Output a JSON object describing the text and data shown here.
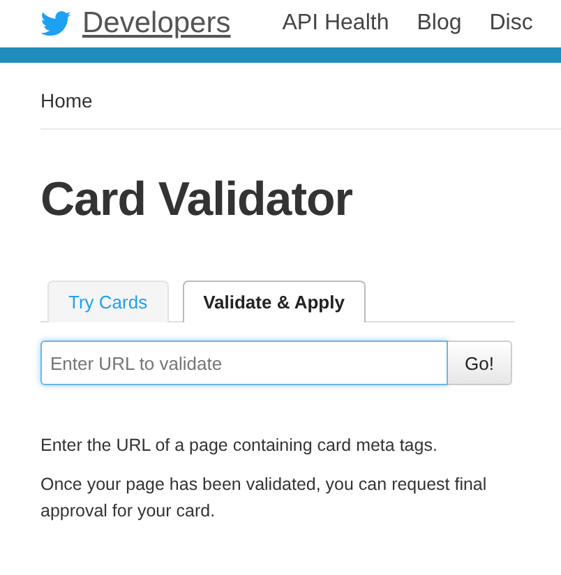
{
  "header": {
    "brand": "Developers",
    "nav": [
      "API Health",
      "Blog",
      "Disc"
    ]
  },
  "breadcrumb": [
    "Home"
  ],
  "title": "Card Validator",
  "tabs": [
    {
      "label": "Try Cards",
      "selected": false
    },
    {
      "label": "Validate & Apply",
      "selected": true
    }
  ],
  "url_field": {
    "placeholder": "Enter URL to validate"
  },
  "go_button": "Go!",
  "paragraphs": [
    "Enter the URL of a page containing card meta tags.",
    "Once your page has been validated, you can request final approval for your card."
  ]
}
